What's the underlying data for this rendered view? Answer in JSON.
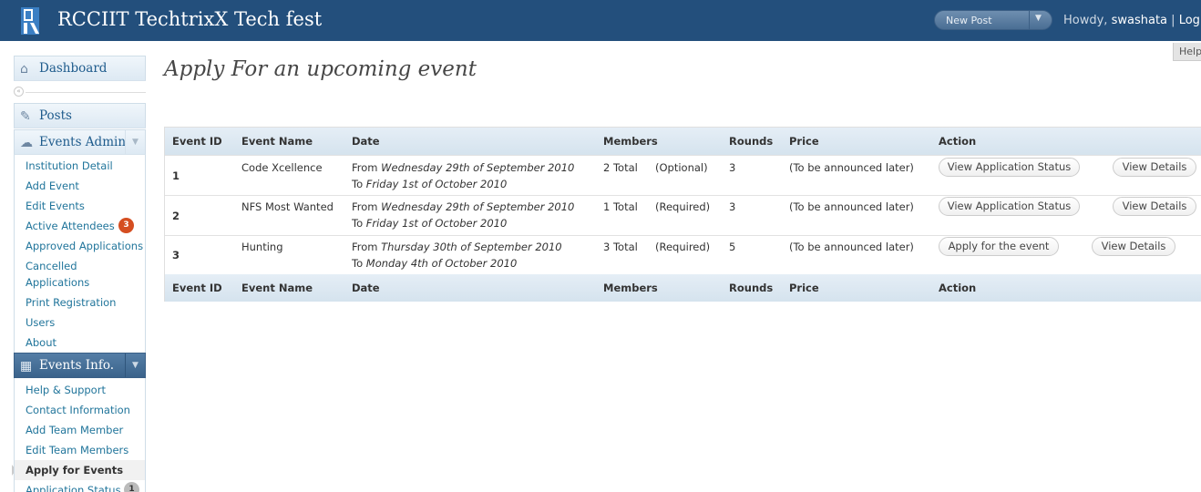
{
  "header": {
    "site_title": "RCCIIT TechtrixX Tech fest",
    "new_post": "New Post",
    "howdy": "Howdy,",
    "username": "swashata",
    "log_out": "Log"
  },
  "help_tab": "Help",
  "sidebar": {
    "dashboard": "Dashboard",
    "posts": "Posts",
    "events_admin": {
      "title": "Events Admin",
      "items": [
        {
          "label": "Institution Detail"
        },
        {
          "label": "Add Event"
        },
        {
          "label": "Edit Events"
        },
        {
          "label": "Active Attendees",
          "badge": "3"
        },
        {
          "label": "Approved Applications"
        },
        {
          "label": "Cancelled"
        },
        {
          "label": "Applications"
        },
        {
          "label": "Print Registration"
        },
        {
          "label": "Users"
        },
        {
          "label": "About"
        }
      ]
    },
    "events_info": {
      "title": "Events Info.",
      "items": [
        {
          "label": "Help & Support"
        },
        {
          "label": "Contact Information"
        },
        {
          "label": "Add Team Member"
        },
        {
          "label": "Edit Team Members"
        },
        {
          "label": "Apply for Events"
        },
        {
          "label": "Application Status",
          "badge": "1"
        }
      ]
    }
  },
  "main": {
    "title": "Apply For an upcoming event",
    "columns": [
      "Event ID",
      "Event Name",
      "Date",
      "Members",
      "Rounds",
      "Price",
      "Action"
    ],
    "rows": [
      {
        "id": "1",
        "name": "Code Xcellence",
        "from_label": "From",
        "from_date": "Wednesday 29th of September 2010",
        "to_label": "To",
        "to_date": "Friday 1st of October 2010",
        "members": "2 Total",
        "members_type": "(Optional)",
        "rounds": "3",
        "price": "(To be announced later)",
        "action": "View Application Status",
        "details": "View Details"
      },
      {
        "id": "2",
        "name": "NFS Most Wanted",
        "from_label": "From",
        "from_date": "Wednesday 29th of September 2010",
        "to_label": "To",
        "to_date": "Friday 1st of October 2010",
        "members": "1 Total",
        "members_type": "(Required)",
        "rounds": "3",
        "price": "(To be announced later)",
        "action": "View Application Status",
        "details": "View Details"
      },
      {
        "id": "3",
        "name": "Hunting",
        "from_label": "From",
        "from_date": "Thursday 30th of September 2010",
        "to_label": "To",
        "to_date": "Monday 4th of October 2010",
        "members": "3 Total",
        "members_type": "(Required)",
        "rounds": "5",
        "price": "(To be announced later)",
        "action": "Apply for the event",
        "details": "View Details"
      }
    ]
  },
  "colors": {
    "header_bg": "#234f7c",
    "link": "#21759b",
    "badge_red": "#d54e21"
  }
}
